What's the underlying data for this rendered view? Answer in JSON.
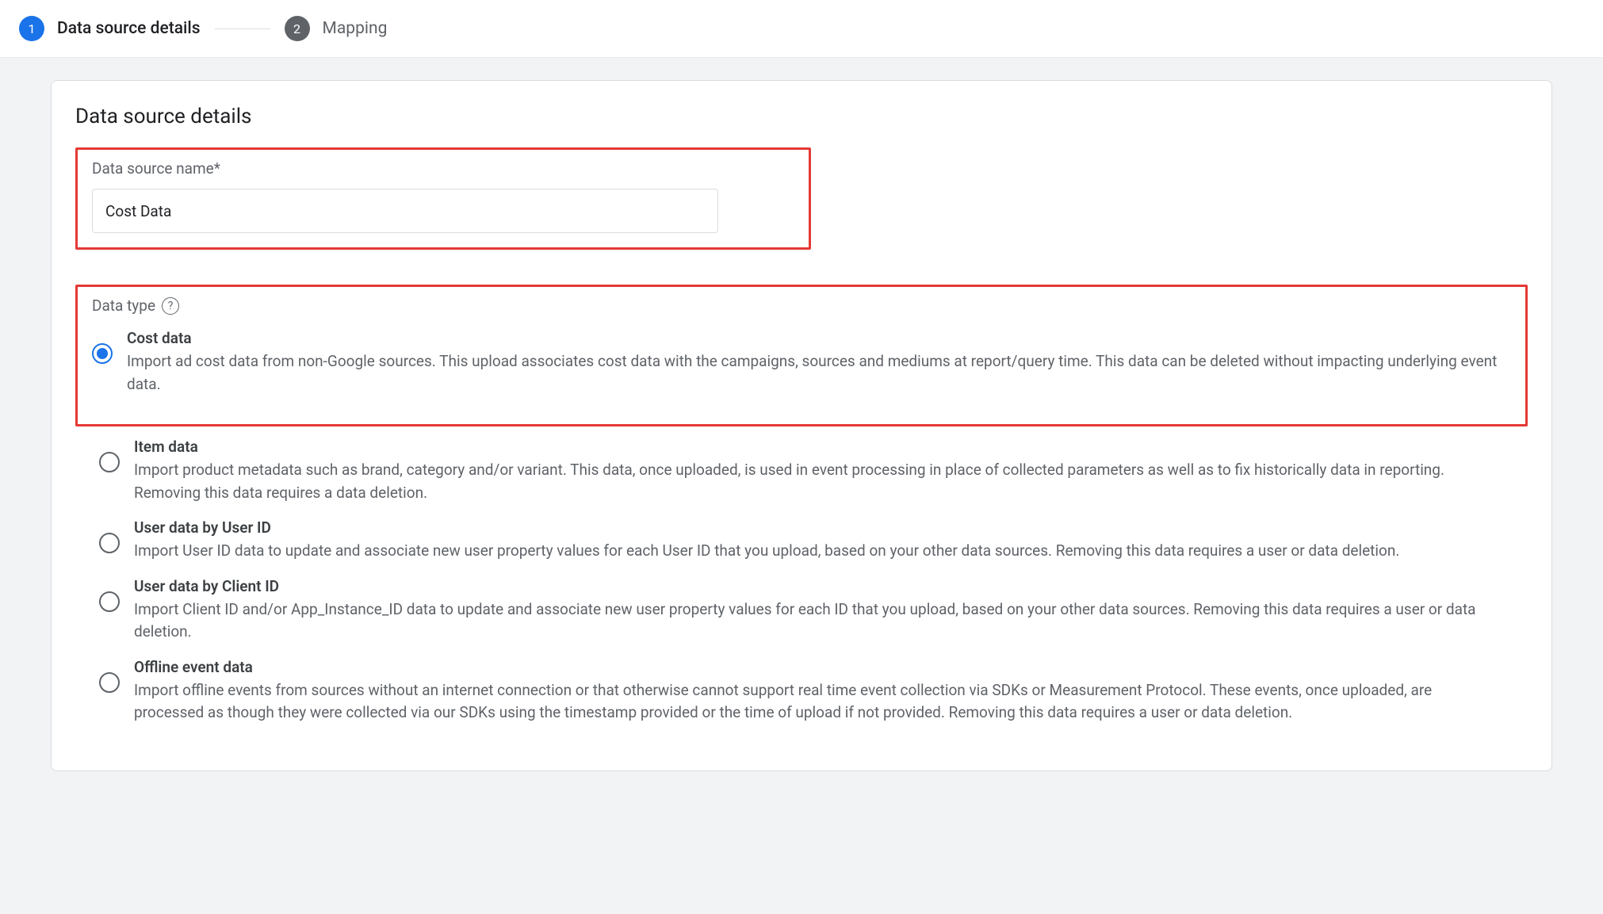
{
  "stepper": {
    "steps": [
      {
        "num": "1",
        "label": "Data source details",
        "active": true
      },
      {
        "num": "2",
        "label": "Mapping",
        "active": false
      }
    ]
  },
  "section": {
    "title": "Data source details",
    "name_field": {
      "label": "Data source name*",
      "value": "Cost Data"
    },
    "data_type": {
      "label": "Data type",
      "options": [
        {
          "title": "Cost data",
          "desc": "Import ad cost data from non-Google sources. This upload associates cost data with the campaigns, sources and mediums at report/query time. This data can be deleted without impacting underlying event data.",
          "selected": true,
          "inside_highlight": true
        },
        {
          "title": "Item data",
          "desc": "Import product metadata such as brand, category and/or variant. This data, once uploaded, is used in event processing in place of collected parameters as well as to fix historically data in reporting. Removing this data requires a data deletion.",
          "selected": false,
          "inside_highlight": false
        },
        {
          "title": "User data by User ID",
          "desc": "Import User ID data to update and associate new user property values for each User ID that you upload, based on your other data sources. Removing this data requires a user or data deletion.",
          "selected": false,
          "inside_highlight": false
        },
        {
          "title": "User data by Client ID",
          "desc": "Import Client ID and/or App_Instance_ID data to update and associate new user property values for each ID that you upload, based on your other data sources. Removing this data requires a user or data deletion.",
          "selected": false,
          "inside_highlight": false
        },
        {
          "title": "Offline event data",
          "desc": "Import offline events from sources without an internet connection or that otherwise cannot support real time event collection via SDKs or Measurement Protocol. These events, once uploaded, are processed as though they were collected via our SDKs using the timestamp provided or the time of upload if not provided. Removing this data requires a user or data deletion.",
          "selected": false,
          "inside_highlight": false
        }
      ]
    }
  }
}
